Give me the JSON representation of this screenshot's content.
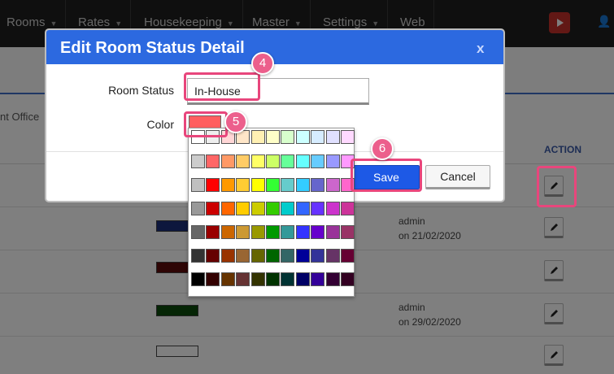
{
  "nav": {
    "items": [
      {
        "label": "Rooms",
        "dropdown": true
      },
      {
        "label": "Rates",
        "dropdown": true
      },
      {
        "label": "Housekeeping",
        "dropdown": true
      },
      {
        "label": "Master",
        "dropdown": true
      },
      {
        "label": "Settings",
        "dropdown": true
      },
      {
        "label": "Web",
        "dropdown": false
      }
    ],
    "youtube_icon": "youtube-icon",
    "user_icon": "user-icon"
  },
  "page": {
    "section_label": "nt Office",
    "table": {
      "action_header": "ACTION",
      "rows": [
        {
          "swatch_color": "",
          "updated": ""
        },
        {
          "swatch_color": "#1a2f7a",
          "updated_by": "admin",
          "updated_on": "on 21/02/2020"
        },
        {
          "swatch_color": "#5c0a0a",
          "updated_by": "",
          "updated_on": ""
        },
        {
          "swatch_color": "#0b4a0b",
          "updated_by": "admin",
          "updated_on": "on 29/02/2020"
        },
        {
          "swatch_color": "#ffffff",
          "updated_by": "",
          "updated_on": ""
        }
      ]
    }
  },
  "modal": {
    "title": "Edit Room Status Detail",
    "close_label": "x",
    "room_status_label": "Room Status",
    "room_status_value": "In-House",
    "color_label": "Color",
    "selected_color": "#ff5f5f",
    "save_label": "Save",
    "cancel_label": "Cancel"
  },
  "palette": {
    "rows": [
      [
        "#ffffff",
        "#eeeeee",
        "#ffd6d6",
        "#ffe6c8",
        "#fff0b3",
        "#ffffc8",
        "#d8ffcc",
        "#ccffff",
        "#d6ecff",
        "#e0e0ff",
        "#ffd9ff"
      ],
      [
        "#cccccc",
        "#ff6666",
        "#ff9966",
        "#ffcc66",
        "#ffff66",
        "#ccff66",
        "#66ff99",
        "#66ffff",
        "#66ccff",
        "#9999ff",
        "#ff99ff"
      ],
      [
        "#c0c0c0",
        "#ff0000",
        "#ff9900",
        "#ffcc33",
        "#ffff00",
        "#33ff33",
        "#66cccc",
        "#33ccff",
        "#6666cc",
        "#cc66cc",
        "#ff66cc"
      ],
      [
        "#999999",
        "#cc0000",
        "#ff6600",
        "#ffcc00",
        "#cccc00",
        "#33cc00",
        "#00cccc",
        "#3366ff",
        "#6633ff",
        "#cc33cc",
        "#cc3399"
      ],
      [
        "#666666",
        "#990000",
        "#cc6600",
        "#cc9933",
        "#999900",
        "#009900",
        "#339999",
        "#3333ff",
        "#6600cc",
        "#993399",
        "#993366"
      ],
      [
        "#333333",
        "#660000",
        "#993300",
        "#996633",
        "#666600",
        "#006600",
        "#336666",
        "#000099",
        "#333399",
        "#663366",
        "#660033"
      ],
      [
        "#000000",
        "#330000",
        "#663300",
        "#663333",
        "#333300",
        "#003300",
        "#003333",
        "#000066",
        "#330099",
        "#330033",
        "#330022"
      ]
    ]
  },
  "annotations": {
    "step_room_status": "4",
    "step_color": "5",
    "step_save": "6"
  },
  "colors": {
    "accent": "#2c69e0",
    "highlight": "#e8467c",
    "nav_bg": "#1e1e1e"
  }
}
